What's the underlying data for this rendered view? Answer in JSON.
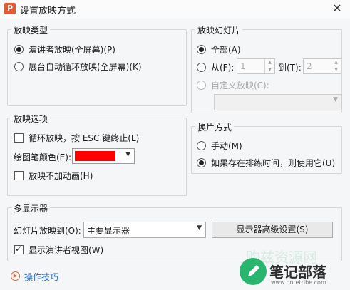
{
  "window": {
    "title": "设置放映方式",
    "close_glyph": "✕",
    "icon_letter": "P"
  },
  "show_type": {
    "title": "放映类型",
    "options": [
      {
        "label": "演讲者放映(全屏幕)(P)",
        "selected": true
      },
      {
        "label": "展台自动循环放映(全屏幕)(K)",
        "selected": false
      }
    ]
  },
  "show_slides": {
    "title": "放映幻灯片",
    "all_label": "全部(A)",
    "from_label": "从(F):",
    "from_value": "1",
    "to_label": "到(T):",
    "to_value": "2",
    "custom_label": "自定义放映(C):",
    "custom_value": ""
  },
  "show_options": {
    "title": "放映选项",
    "loop_label": "循环放映，按 ESC 键终止(L)",
    "loop_checked": false,
    "pen_color_label": "绘图笔颜色(E):",
    "pen_color": "#ff0000",
    "no_animation_label": "放映不加动画(H)",
    "no_animation_checked": false
  },
  "advance": {
    "title": "换片方式",
    "manual_label": "手动(M)",
    "timings_label": "如果存在排练时间，则使用它(U)",
    "selected": "timings"
  },
  "multi_display": {
    "title": "多显示器",
    "show_on_label": "幻灯片放映到(O):",
    "show_on_value": "主要显示器",
    "advanced_button": "显示器高级设置(S)",
    "presenter_view_label": "显示演讲者视图(W)",
    "presenter_view_checked": true
  },
  "footer": {
    "help_label": "操作技巧"
  },
  "watermark": {
    "brand": "笔记部落",
    "url": "www.notetribe.com",
    "faint": "购兹资源网"
  }
}
